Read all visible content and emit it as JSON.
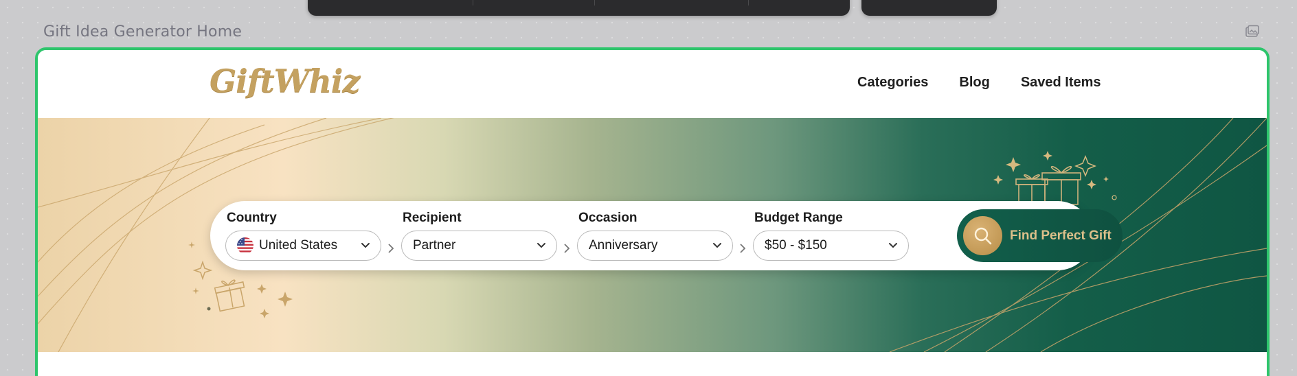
{
  "frame": {
    "title": "Gift Idea Generator Home"
  },
  "header": {
    "logo": "GiftWhiz",
    "nav": [
      "Categories",
      "Blog",
      "Saved Items"
    ]
  },
  "search": {
    "fields": [
      {
        "label": "Country",
        "value": "United States"
      },
      {
        "label": "Recipient",
        "value": "Partner"
      },
      {
        "label": "Occasion",
        "value": "Anniversary"
      },
      {
        "label": "Budget Range",
        "value": "$50 - $150"
      }
    ],
    "submit_label": "Find Perfect Gift"
  },
  "colors": {
    "frame_border": "#2ec56c",
    "brand_gold": "#c4a160",
    "brand_green": "#125f4b"
  },
  "icons": [
    "us-flag-icon",
    "chevron-down-icon",
    "chevron-right-icon",
    "search-icon",
    "gift-icon",
    "sparkle-icon",
    "image-icon"
  ]
}
